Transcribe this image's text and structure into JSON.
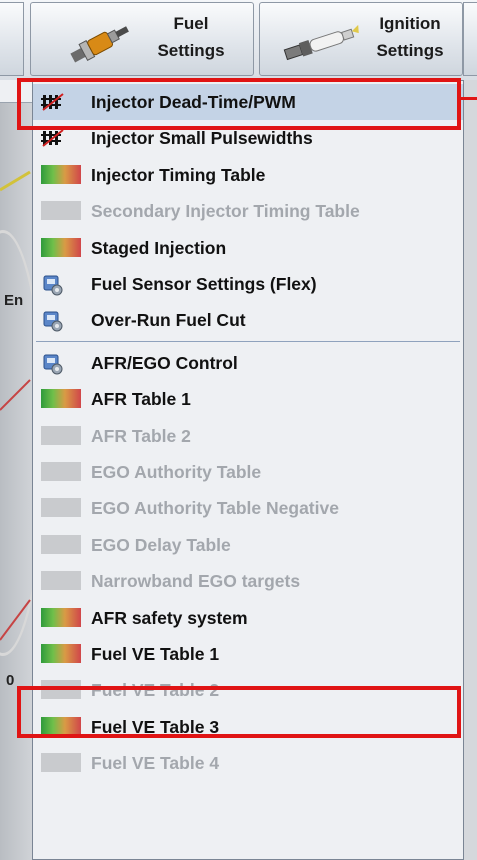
{
  "toolbar": {
    "fuel_button": {
      "line1": "Fuel",
      "line2": "Settings",
      "icon": "fuel-injector-icon"
    },
    "ignition_button": {
      "line1": "Ignition",
      "line2": "Settings",
      "icon": "spark-plug-icon"
    }
  },
  "background": {
    "label_fragment": "En",
    "digit": "0"
  },
  "menu": {
    "items": [
      {
        "label": "Injector Dead-Time/PWM",
        "icon": "pwm-icon",
        "enabled": true,
        "selected": true
      },
      {
        "label": "Injector Small Pulsewidths",
        "icon": "pwm-icon",
        "enabled": true
      },
      {
        "label": "Injector Timing Table",
        "icon": "table-icon",
        "enabled": true
      },
      {
        "label": "Secondary Injector Timing Table",
        "icon": "table-icon",
        "enabled": false
      },
      {
        "label": "Staged Injection",
        "icon": "table-icon",
        "enabled": true
      },
      {
        "label": "Fuel Sensor Settings (Flex)",
        "icon": "settings-dialog-icon",
        "enabled": true
      },
      {
        "label": "Over-Run Fuel Cut",
        "icon": "settings-dialog-icon",
        "enabled": true
      },
      {
        "label": "AFR/EGO Control",
        "icon": "settings-dialog-icon",
        "enabled": true
      },
      {
        "label": "AFR Table 1",
        "icon": "table-icon",
        "enabled": true
      },
      {
        "label": "AFR Table 2",
        "icon": "table-icon",
        "enabled": false
      },
      {
        "label": "EGO Authority Table",
        "icon": "table-icon",
        "enabled": false
      },
      {
        "label": "EGO Authority Table Negative",
        "icon": "table-icon",
        "enabled": false
      },
      {
        "label": "EGO Delay Table",
        "icon": "table-icon",
        "enabled": false
      },
      {
        "label": "Narrowband EGO targets",
        "icon": "table-icon",
        "enabled": false
      },
      {
        "label": "AFR safety system",
        "icon": "table-icon",
        "enabled": true
      },
      {
        "label": "Fuel VE Table 1",
        "icon": "table-icon",
        "enabled": true,
        "highlighted": true
      },
      {
        "label": "Fuel VE Table 2",
        "icon": "table-icon",
        "enabled": false
      },
      {
        "label": "Fuel VE Table 3",
        "icon": "table-icon",
        "enabled": true
      },
      {
        "label": "Fuel VE Table 4",
        "icon": "table-icon",
        "enabled": false
      }
    ]
  },
  "colors": {
    "highlight_box": "#e01414",
    "selected_row": "#c4d3e6",
    "disabled_text": "#a3a7ad"
  }
}
